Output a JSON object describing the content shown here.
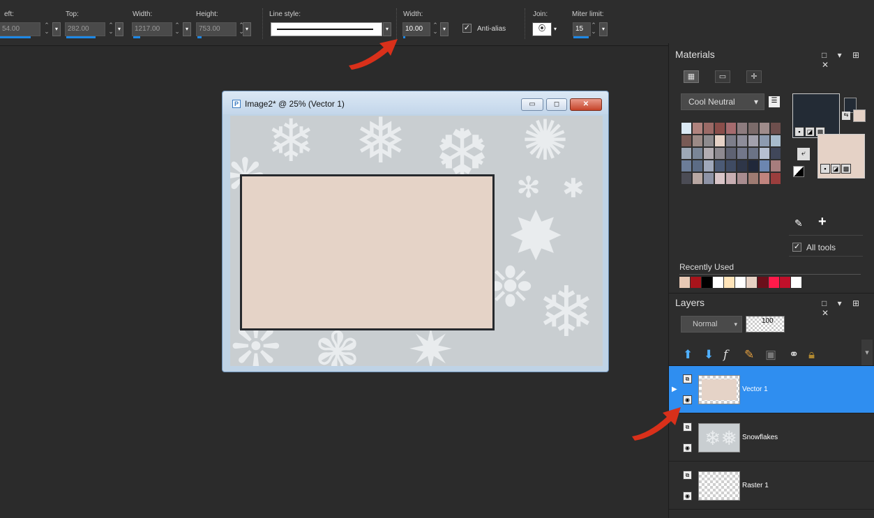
{
  "toolbar": {
    "left_label": "eft:",
    "left_value": "54.00",
    "top_label": "Top:",
    "top_value": "282.00",
    "width_label": "Width:",
    "width_value": "1217.00",
    "height_label": "Height:",
    "height_value": "753.00",
    "line_style_label": "Line style:",
    "stroke_width_label": "Width:",
    "stroke_width_value": "10.00",
    "antialias_label": "Anti-alias",
    "antialias_checked": true,
    "join_label": "Join:",
    "miter_label": "Miter limit:",
    "miter_value": "15"
  },
  "image_window": {
    "title": "Image2* @  25% (Vector 1)",
    "minimize": "▭",
    "restore": "◻",
    "close": "✕",
    "canvas_bg": "#c9ced1",
    "rect_fill": "#e5d3c7",
    "rect_stroke": "#26292d"
  },
  "materials": {
    "title": "Materials",
    "panel_controls": "□ ▾ ⊞ ✕",
    "palette_dropdown": "Cool Neutral",
    "palette_colors": [
      "#dbe9f4",
      "#b0837e",
      "#9b6a66",
      "#8a4e4a",
      "#a56b6e",
      "#8d7c7f",
      "#7b6b6a",
      "#9f8c8b",
      "#6e4f4d",
      "#785a55",
      "#9b8a86",
      "#8e8b8e",
      "#e6d2c6",
      "#7d7e8a",
      "#8d8d9a",
      "#a2a1ad",
      "#8d9bb0",
      "#a8bccd",
      "#9da8b6",
      "#7a8697",
      "#b3adb2",
      "#8e8a90",
      "#5e6272",
      "#72778a",
      "#6b7386",
      "#b6bfd1",
      "#40475a",
      "#6c7d98",
      "#5c6c85",
      "#9fa8bb",
      "#4b5a75",
      "#3f4b63",
      "#2e3648",
      "#20283a",
      "#6c86b0",
      "#a77d7d",
      "#4b4c55",
      "#b8a7a2",
      "#8e93a6",
      "#d9c5c8",
      "#c7aeb2",
      "#a88c8f",
      "#9e7b72",
      "#c0847e",
      "#9b3e3d"
    ],
    "foreground_color": "#232b35",
    "background_color": "#e5d2c6",
    "all_tools_label": "All tools",
    "all_tools_checked": true,
    "recently_used_label": "Recently Used",
    "recent_colors": [
      "#e8c9b5",
      "#a8141b",
      "#000000",
      "#ffffff",
      "#ffe4b9",
      "#ffffff",
      "#e7d2c4",
      "#6b0f1a",
      "#ff1a4a",
      "#c0102a",
      "#ffffff"
    ]
  },
  "layers": {
    "title": "Layers",
    "panel_controls": "□ ▾ ⊞ ✕",
    "blend_mode": "Normal",
    "opacity": "100",
    "items": [
      {
        "name": "Vector 1",
        "selected": true
      },
      {
        "name": "Snowflakes",
        "selected": false
      },
      {
        "name": "Raster 1",
        "selected": false
      }
    ]
  },
  "icons": {
    "arrow_color": "#d9301a",
    "layer_toolbar": [
      "new-raster-layer-icon",
      "new-vector-layer-icon",
      "layer-effects-icon",
      "paintbrush-icon",
      "mask-icon",
      "link-icon",
      "lock-icon"
    ]
  }
}
